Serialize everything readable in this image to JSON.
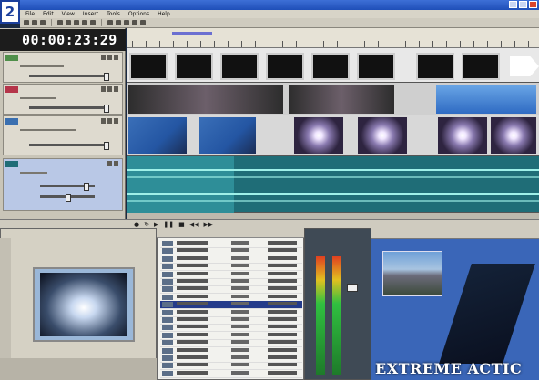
{
  "app": {
    "logo_letter": "2",
    "menu": [
      "File",
      "Edit",
      "View",
      "Insert",
      "Tools",
      "Options",
      "Help"
    ]
  },
  "timeline": {
    "timecode": "00:00:23:29"
  },
  "preview": {
    "caption": "EXTREME ACTIC"
  },
  "colors": {
    "titlebar": "#2a58c4",
    "track_video_1": "#4f8f4a",
    "track_video_2": "#b5354a",
    "track_video_3": "#3a6fb0",
    "track_audio": "#1f6d77"
  },
  "icons": [
    "window-minimize-icon",
    "window-maximize-icon",
    "window-close-icon",
    "play-icon",
    "stop-icon",
    "rewind-icon",
    "fast-forward-icon",
    "folder-icon",
    "mute-icon",
    "solo-icon"
  ]
}
